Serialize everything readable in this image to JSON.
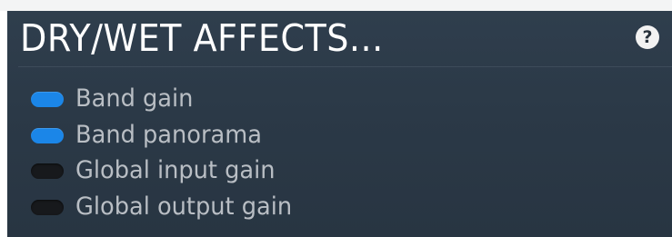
{
  "header": {
    "title": "DRY/WET AFFECTS...",
    "help_label": "?"
  },
  "colors": {
    "panel_background": "#2b3947",
    "toggle_on": "#1b86e8",
    "toggle_off": "#17191c",
    "label_text": "#b9bec4"
  },
  "options": [
    {
      "label": "Band gain",
      "enabled": true
    },
    {
      "label": "Band panorama",
      "enabled": true
    },
    {
      "label": "Global input gain",
      "enabled": false
    },
    {
      "label": "Global output gain",
      "enabled": false
    }
  ]
}
